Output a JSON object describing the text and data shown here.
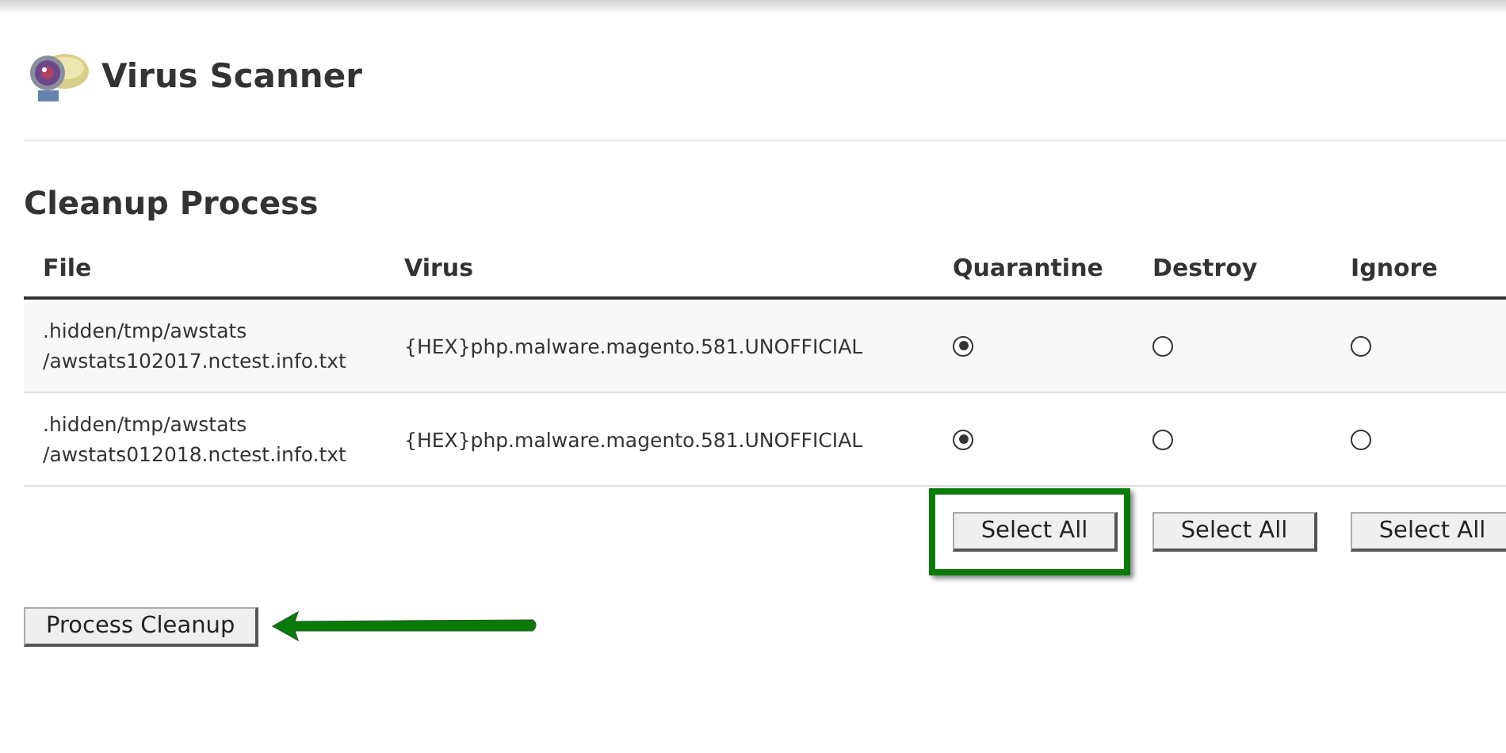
{
  "page": {
    "title": "Virus Scanner"
  },
  "section": {
    "title": "Cleanup Process"
  },
  "table": {
    "columns": [
      "File",
      "Virus",
      "Quarantine",
      "Destroy",
      "Ignore"
    ],
    "rows": [
      {
        "file": [
          ".hidden/tmp/awstats",
          "/awstats102017.nctest.info.txt"
        ],
        "virus": "{HEX}php.malware.magento.581.UNOFFICIAL",
        "options": [
          {
            "selected": true
          },
          {
            "selected": false
          },
          {
            "selected": false
          }
        ]
      },
      {
        "file": [
          ".hidden/tmp/awstats",
          "/awstats012018.nctest.info.txt"
        ],
        "virus": "{HEX}php.malware.magento.581.UNOFFICIAL",
        "options": [
          {
            "selected": true
          },
          {
            "selected": false
          },
          {
            "selected": false
          }
        ]
      }
    ],
    "select_all": [
      {
        "label": "Select All",
        "highlighted": true
      },
      {
        "label": "Select All",
        "highlighted": false
      },
      {
        "label": "Select All",
        "highlighted": false
      }
    ]
  },
  "process_button": {
    "label": "Process Cleanup",
    "pointed_at": true
  }
}
